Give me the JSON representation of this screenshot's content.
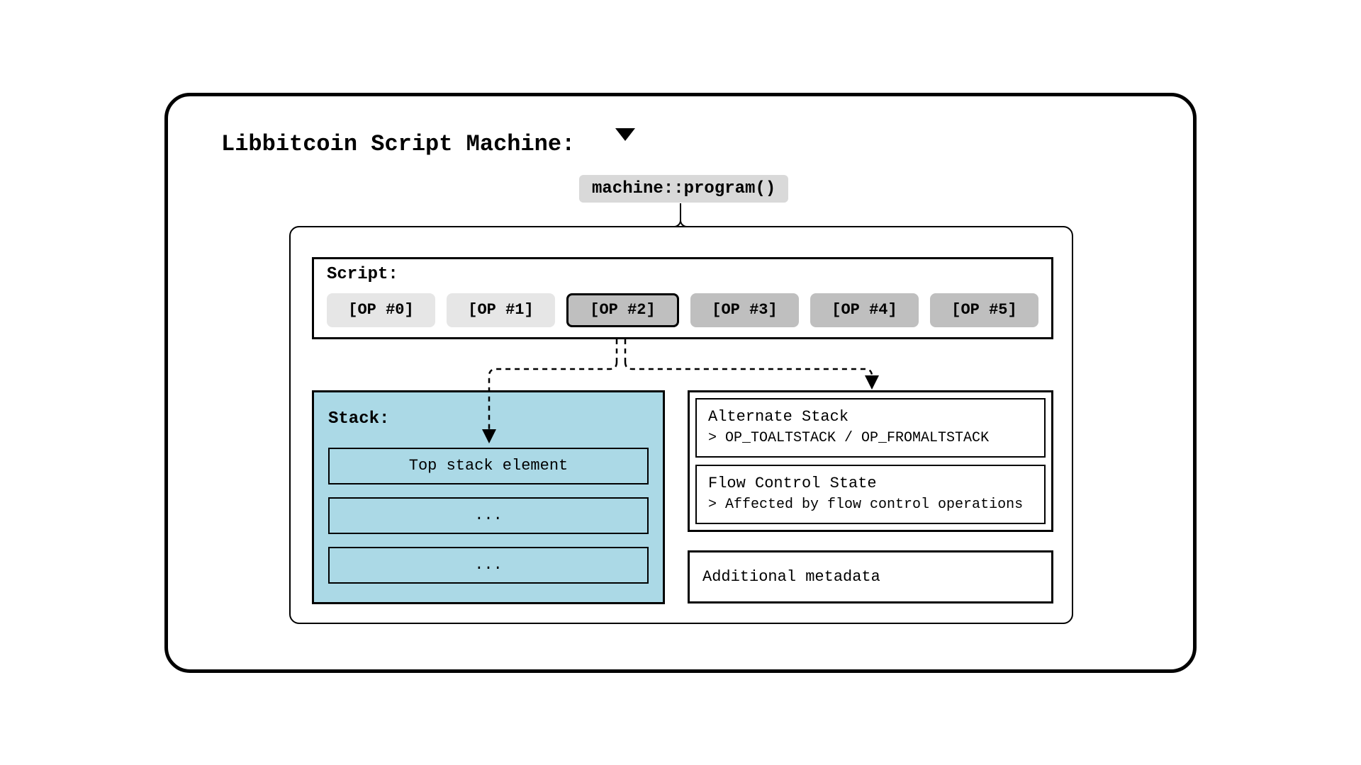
{
  "title": "Libbitcoin Script Machine:",
  "program_label": "machine::program()",
  "script": {
    "label": "Script:",
    "ops": [
      "[OP #0]",
      "[OP #1]",
      "[OP #2]",
      "[OP #3]",
      "[OP #4]",
      "[OP #5]"
    ],
    "current_index": 2
  },
  "stack": {
    "label": "Stack:",
    "items": [
      "Top stack element",
      "...",
      "..."
    ]
  },
  "alt_stack": {
    "title": "Alternate Stack",
    "sub": "> OP_TOALTSTACK / OP_FROMALTSTACK"
  },
  "flow": {
    "title": "Flow Control State",
    "sub": "> Affected by flow control operations"
  },
  "metadata_label": "Additional metadata"
}
